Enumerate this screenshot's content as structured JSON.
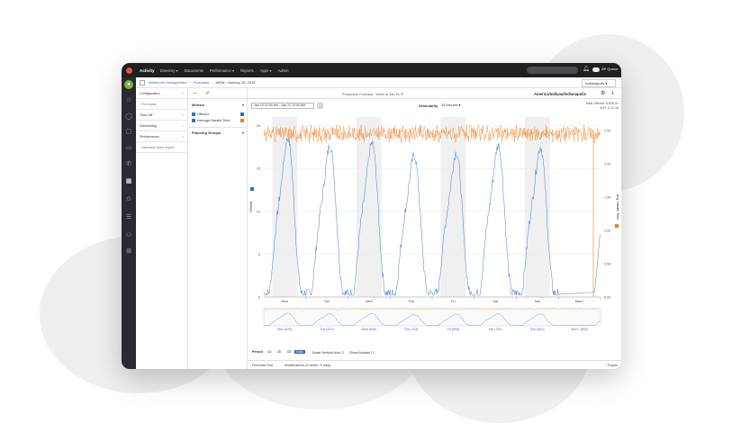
{
  "app": {
    "title": "Activity",
    "nav": [
      "Directory ▾",
      "Documents",
      "Performance ▾",
      "Reports",
      "Apps ▾",
      "Admin"
    ],
    "user": "AP Queue"
  },
  "breadcrumb": {
    "section": "Workforce Management",
    "page": "Forecasts",
    "current": "WEM / January 15, 2024"
  },
  "timezone_select": "Indianapolis",
  "left_nav": {
    "items": [
      {
        "label": "Configuration",
        "chevron": "›"
      },
      {
        "label": "Forecasts",
        "chevron": ""
      },
      {
        "label": "Time Off",
        "chevron": "›"
      },
      {
        "label": "Scheduling",
        "chevron": "›"
      },
      {
        "label": "Performance",
        "chevron": "›"
      },
      {
        "label": "Historical Data Import",
        "chevron": ""
      }
    ]
  },
  "metrics_panel": {
    "toolbar": [
      "—",
      "↺"
    ],
    "heading": "Metrics",
    "items": [
      {
        "label": "Offered",
        "color": "#2f6fc6"
      },
      {
        "label": "Average Handle Time",
        "color": "#f07f1f"
      }
    ],
    "planning_groups": "Planning Groups"
  },
  "main": {
    "subtitle": "Production Forecast - Week of Jan 15 ↺",
    "location": "America/Indiana/Indianapolis",
    "date_range": "Jan 15 12:00 AM - Jan 21 12:00 AM",
    "granularity_label": "Granularity",
    "granularity_value": "15 minutes ▾",
    "total_offered": "Total Offered: 6,835.41",
    "total_aht": "AHT: 2:21:18"
  },
  "chart_data": {
    "type": "line",
    "categories": [
      "Mon",
      "Tue",
      "Wed",
      "Thu",
      "Fri",
      "Sat",
      "Sun",
      "Mon+"
    ],
    "y_ticks_left": [
      "0",
      "5",
      "10",
      "15",
      "20"
    ],
    "y_ticks_right": [
      "0.00",
      "0.50",
      "1.00",
      "1.50",
      "2.00",
      "2.50"
    ],
    "ylim_left": [
      0,
      21
    ],
    "ylim_right": [
      0,
      2.7
    ],
    "ylabel_left": "Offered",
    "ylabel_right": "Avg Handle Time",
    "series": [
      {
        "name": "Offered",
        "color": "#2f6fc6",
        "daily_peaks": [
          20.5,
          19.5,
          19.8,
          18.2,
          18.6,
          19.5,
          19.3,
          8.0
        ]
      },
      {
        "name": "Average Handle Time",
        "color": "#f07f1f",
        "mean": 2.45
      }
    ],
    "overview_labels": [
      "Mon (879)",
      "Tue (874)",
      "Wed (920)",
      "Thu (713)",
      "Fri (959)",
      "Sat (703)",
      "Sun (642)",
      "Mon+ (859)"
    ]
  },
  "bottom": {
    "period_label": "Period",
    "periods": [
      "1D",
      "2D",
      "3D",
      "Max"
    ],
    "scale_label": "Scale Vertical Axis",
    "actuals_label": "Show Actuals"
  },
  "tabs": [
    "Forecast Grid",
    "Modifications (5 active, 5 total)"
  ],
  "expand_label": "^ Expan"
}
